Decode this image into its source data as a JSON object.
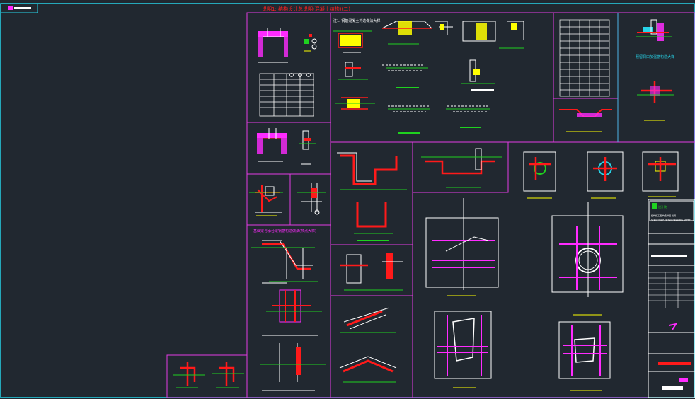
{
  "drawing": {
    "title": "说明1: 结构设计总说明(混凝土结构)(二)",
    "section_note_left": "基础梁与承台梁钢筋构造做法(节点大样)",
    "section_note_mid": "注1. 钢筋混凝土构造做法大样",
    "detail_note_tr": "预留洞口加强筋构造大样",
    "titleblock_company": "设计院",
    "titleblock_line1": "结构施工图 构造详图 说明",
    "titleblock_line2": "STRUCTURE DETAIL DRAWING SHEET"
  },
  "colors": {
    "background": "#212830",
    "frame": "#27d3e8",
    "sheet_border": "#e43ce4",
    "lines": "#ffffff",
    "rebar": "#ff1a1a",
    "dims": "#1fd11f",
    "highlight": "#ffff00",
    "hatch": "#ff2bff"
  }
}
